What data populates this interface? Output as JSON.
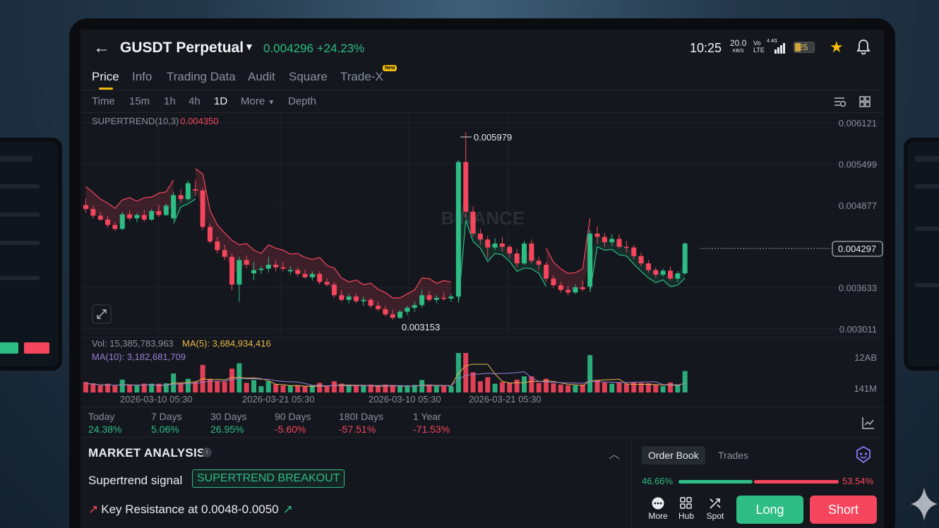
{
  "header": {
    "back_icon": "back-arrow-icon",
    "pair": "GUSDT Perpetual",
    "price_change": "0.004296 +24.23%",
    "time": "10:25",
    "net_speed": "20.0",
    "net_unit": "KB/S",
    "vo": "Vo",
    "lte": "LTE",
    "signal": "4.4G",
    "battery": "25"
  },
  "tabs": [
    {
      "label": "Price",
      "active": true
    },
    {
      "label": "Info"
    },
    {
      "label": "Trading Data"
    },
    {
      "label": "Audit"
    },
    {
      "label": "Square"
    },
    {
      "label": "Trade-X",
      "badge": "New"
    }
  ],
  "intervals": [
    "Time",
    "15m",
    "1h",
    "4h",
    "1D",
    "More",
    "Depth"
  ],
  "active_interval": "1D",
  "chart_data": {
    "type": "candlestick",
    "indicator_label": "SUPERTREND(10,3)",
    "indicator_value": "0.004350",
    "y_ticks": [
      "0.006121",
      "0.005499",
      "0.004877",
      "0.003633",
      "0.003011"
    ],
    "last_price": "0.004297",
    "high_label": "0.005979",
    "low_label": "0.003153",
    "watermark": "BINANCE",
    "ylim": [
      0.003011,
      0.006121
    ],
    "candles": [
      [
        0.00488,
        0.00498,
        0.00476,
        0.00482
      ],
      [
        0.00482,
        0.00487,
        0.00468,
        0.00472
      ],
      [
        0.00472,
        0.00478,
        0.00464,
        0.00466
      ],
      [
        0.00466,
        0.00472,
        0.00454,
        0.00458
      ],
      [
        0.00458,
        0.00462,
        0.00449,
        0.00452
      ],
      [
        0.00452,
        0.00478,
        0.0045,
        0.00474
      ],
      [
        0.00474,
        0.0048,
        0.00465,
        0.00468
      ],
      [
        0.00468,
        0.00476,
        0.00462,
        0.00473
      ],
      [
        0.00473,
        0.00481,
        0.00463,
        0.00466
      ],
      [
        0.00466,
        0.00482,
        0.00464,
        0.00479
      ],
      [
        0.00479,
        0.00488,
        0.0047,
        0.00473
      ],
      [
        0.00473,
        0.0049,
        0.00471,
        0.00487
      ],
      [
        0.00468,
        0.00508,
        0.00465,
        0.00503
      ],
      [
        0.00503,
        0.00512,
        0.00492,
        0.00497
      ],
      [
        0.00497,
        0.00525,
        0.00495,
        0.00521
      ],
      [
        0.00512,
        0.00525,
        0.00502,
        0.0051
      ],
      [
        0.0051,
        0.00514,
        0.0045,
        0.00455
      ],
      [
        0.00455,
        0.0046,
        0.0043,
        0.00433
      ],
      [
        0.00433,
        0.0044,
        0.00415,
        0.0042
      ],
      [
        0.0042,
        0.00428,
        0.00405,
        0.0041
      ],
      [
        0.0041,
        0.00415,
        0.0036,
        0.00368
      ],
      [
        0.00368,
        0.0041,
        0.00342,
        0.00405
      ],
      [
        0.00405,
        0.00412,
        0.00392,
        0.00398
      ],
      [
        0.00385,
        0.00402,
        0.00375,
        0.0039
      ],
      [
        0.0039,
        0.00396,
        0.00384,
        0.00392
      ],
      [
        0.00392,
        0.0041,
        0.00386,
        0.00398
      ],
      [
        0.00398,
        0.00405,
        0.00388,
        0.00394
      ],
      [
        0.00394,
        0.00402,
        0.00388,
        0.00392
      ],
      [
        0.00388,
        0.00396,
        0.00383,
        0.0039
      ],
      [
        0.0039,
        0.00394,
        0.0038,
        0.00384
      ],
      [
        0.00384,
        0.0039,
        0.00377,
        0.00379
      ],
      [
        0.00379,
        0.00388,
        0.00374,
        0.00384
      ],
      [
        0.00384,
        0.00388,
        0.00368,
        0.00372
      ],
      [
        0.00372,
        0.00378,
        0.00365,
        0.00368
      ],
      [
        0.00368,
        0.00372,
        0.00348,
        0.00352
      ],
      [
        0.00352,
        0.0036,
        0.00342,
        0.00345
      ],
      [
        0.00345,
        0.00354,
        0.0034,
        0.0035
      ],
      [
        0.0035,
        0.00355,
        0.0034,
        0.00343
      ],
      [
        0.00343,
        0.0035,
        0.00336,
        0.00345
      ],
      [
        0.00345,
        0.00348,
        0.00332,
        0.00336
      ],
      [
        0.00336,
        0.00342,
        0.00328,
        0.00331
      ],
      [
        0.00331,
        0.00336,
        0.0032,
        0.00323
      ],
      [
        0.00323,
        0.0033,
        0.00315,
        0.00318
      ],
      [
        0.00318,
        0.0033,
        0.00316,
        0.00327
      ],
      [
        0.00327,
        0.00336,
        0.00322,
        0.00333
      ],
      [
        0.00333,
        0.00342,
        0.00327,
        0.00337
      ],
      [
        0.00337,
        0.0036,
        0.00333,
        0.00352
      ],
      [
        0.00352,
        0.00358,
        0.00342,
        0.00345
      ],
      [
        0.00345,
        0.00352,
        0.0034,
        0.00348
      ],
      [
        0.00348,
        0.00356,
        0.00344,
        0.00347
      ],
      [
        0.00347,
        0.00354,
        0.00342,
        0.0035
      ],
      [
        0.0035,
        0.00556,
        0.00346,
        0.00553
      ],
      [
        0.00553,
        0.00598,
        0.0047,
        0.00478
      ],
      [
        0.00478,
        0.00486,
        0.0044,
        0.00445
      ],
      [
        0.00445,
        0.00452,
        0.00428,
        0.00436
      ],
      [
        0.00436,
        0.00442,
        0.00408,
        0.00424
      ],
      [
        0.00424,
        0.00438,
        0.0042,
        0.0043
      ],
      [
        0.0043,
        0.0044,
        0.00418,
        0.00425
      ],
      [
        0.00425,
        0.00428,
        0.00408,
        0.00415
      ],
      [
        0.00415,
        0.00422,
        0.00394,
        0.004
      ],
      [
        0.004,
        0.00434,
        0.00398,
        0.0043
      ],
      [
        0.0043,
        0.00436,
        0.004,
        0.00404
      ],
      [
        0.00404,
        0.0041,
        0.0039,
        0.00398
      ],
      [
        0.00398,
        0.00402,
        0.00372,
        0.00377
      ],
      [
        0.00377,
        0.00382,
        0.00363,
        0.00367
      ],
      [
        0.00367,
        0.00372,
        0.00356,
        0.0036
      ],
      [
        0.0036,
        0.00366,
        0.00352,
        0.00356
      ],
      [
        0.00356,
        0.00368,
        0.00354,
        0.00364
      ],
      [
        0.00364,
        0.00374,
        0.00358,
        0.00361
      ],
      [
        0.00365,
        0.0045,
        0.00362,
        0.00445
      ],
      [
        0.00445,
        0.00456,
        0.0043,
        0.0044
      ],
      [
        0.0044,
        0.00446,
        0.00425,
        0.00432
      ],
      [
        0.00432,
        0.00444,
        0.00426,
        0.00437
      ],
      [
        0.00437,
        0.00444,
        0.00423,
        0.00425
      ],
      [
        0.00425,
        0.00434,
        0.00416,
        0.00424
      ],
      [
        0.00424,
        0.00428,
        0.00406,
        0.00411
      ],
      [
        0.00411,
        0.00416,
        0.00396,
        0.004
      ],
      [
        0.004,
        0.00405,
        0.00386,
        0.0039
      ],
      [
        0.0039,
        0.00394,
        0.00378,
        0.00383
      ],
      [
        0.00383,
        0.00392,
        0.0038,
        0.00389
      ],
      [
        0.00389,
        0.00395,
        0.00374,
        0.00377
      ],
      [
        0.00377,
        0.00388,
        0.00372,
        0.00385
      ],
      [
        0.00385,
        0.00432,
        0.00383,
        0.0043
      ]
    ],
    "volume": {
      "label": "Vol: 15,385,783,963",
      "ma5": "MA(5): 3,684,934,416",
      "ma10": "MA(10): 3,182,681,709",
      "y_ticks": [
        "12AB",
        "141M"
      ],
      "x_ticks": [
        "2026-03-10 05:30",
        "2026-03-21 05:30",
        "2026-03-10 05:30",
        "2026-03-21 05:30"
      ]
    }
  },
  "periods": [
    {
      "label": "Today",
      "value": "24.38%",
      "dir": "up"
    },
    {
      "label": "7 Days",
      "value": "5.06%",
      "dir": "up"
    },
    {
      "label": "30 Days",
      "value": "26.95%",
      "dir": "up"
    },
    {
      "label": "90 Days",
      "value": "-5.60%",
      "dir": "dn"
    },
    {
      "label": "180I Days",
      "value": "-57.51%",
      "dir": "dn"
    },
    {
      "label": "1 Year",
      "value": "-71.53%",
      "dir": "dn"
    }
  ],
  "analysis": {
    "title": "MARKET ANALYSIS",
    "signal_label": "Supertrend signal",
    "signal_badge": "SUPERTREND BREAKOUT",
    "key_resistance": "Key Resistance at 0.0048-0.0050"
  },
  "trade_panel": {
    "tab_order_book": "Order Book",
    "tab_trades": "Trades",
    "buy_pct": "46.66%",
    "sell_pct": "53.54%",
    "buy_ratio": 0.4666,
    "more": "More",
    "hub": "Hub",
    "spot": "Spot",
    "long": "Long",
    "short": "Short"
  },
  "colors": {
    "up": "#2ebd85",
    "down": "#f6465d",
    "accent": "#f0b90b"
  }
}
